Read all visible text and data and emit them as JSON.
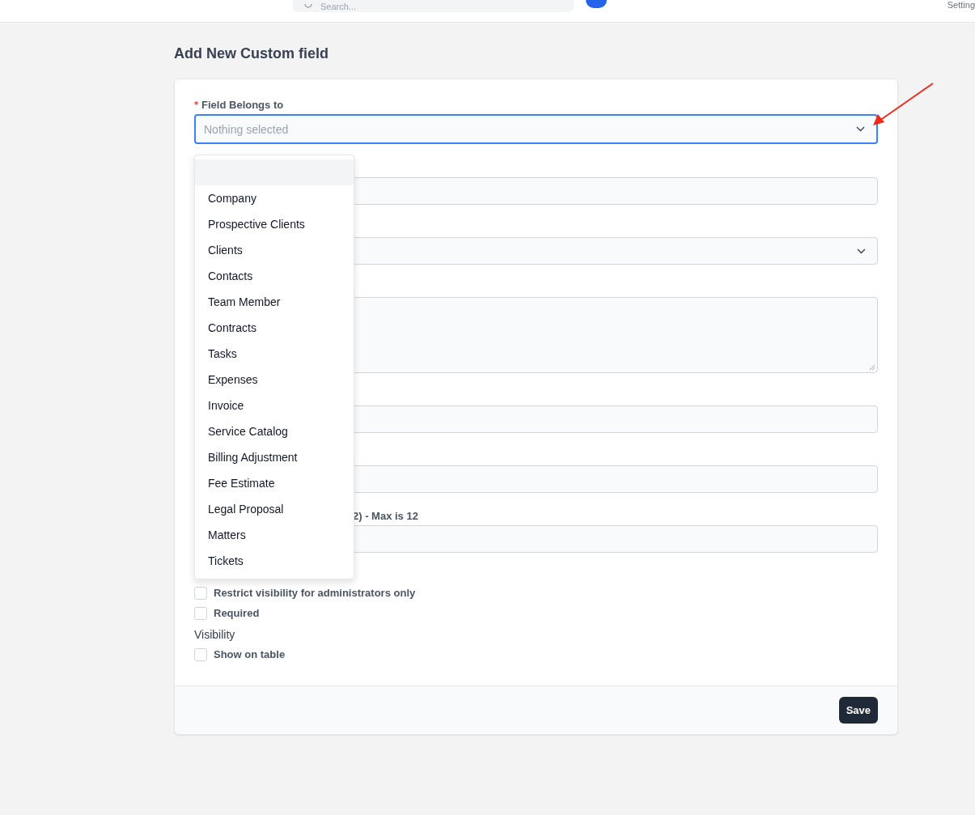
{
  "top_bar": {
    "search": {
      "placeholder": "Search..."
    },
    "settings_link": "Setting"
  },
  "page_title": "Add New Custom field",
  "belongs_to": {
    "label": "Field Belongs to",
    "required_mark": "*",
    "placeholder": "Nothing selected",
    "focused": true,
    "dropdown": {
      "blank_option_highlighted": true,
      "options": [
        {
          "label": "Company",
          "selected": false
        },
        {
          "label": "Prospective Clients",
          "selected": false
        },
        {
          "label": "Clients",
          "selected": false
        },
        {
          "label": "Contacts",
          "selected": false
        },
        {
          "label": "Team Member",
          "selected": false
        },
        {
          "label": "Contracts",
          "selected": false
        },
        {
          "label": "Tasks",
          "selected": false
        },
        {
          "label": "Expenses",
          "selected": false
        },
        {
          "label": "Invoice",
          "selected": false
        },
        {
          "label": "Service Catalog",
          "selected": false
        },
        {
          "label": "Billing Adjustment",
          "selected": false
        },
        {
          "label": "Fee Estimate",
          "selected": false
        },
        {
          "label": "Legal Proposal",
          "selected": false
        },
        {
          "label": "Matters",
          "selected": false
        },
        {
          "label": "Tickets",
          "selected": false
        }
      ]
    }
  },
  "fields": [
    {
      "kind": "input"
    },
    {
      "kind": "select"
    },
    {
      "kind": "textarea"
    },
    {
      "kind": "input"
    },
    {
      "kind": "input"
    },
    {
      "kind": "input",
      "label": "2) - Max is 12"
    }
  ],
  "checkboxes": [
    {
      "label": "Restrict visibility for administrators only",
      "checked": false
    },
    {
      "label": "Required",
      "checked": false
    }
  ],
  "visibility": {
    "heading": "Visibility",
    "checkboxes": [
      {
        "label": "Show on table",
        "checked": false
      }
    ]
  },
  "save_button": "Save"
}
